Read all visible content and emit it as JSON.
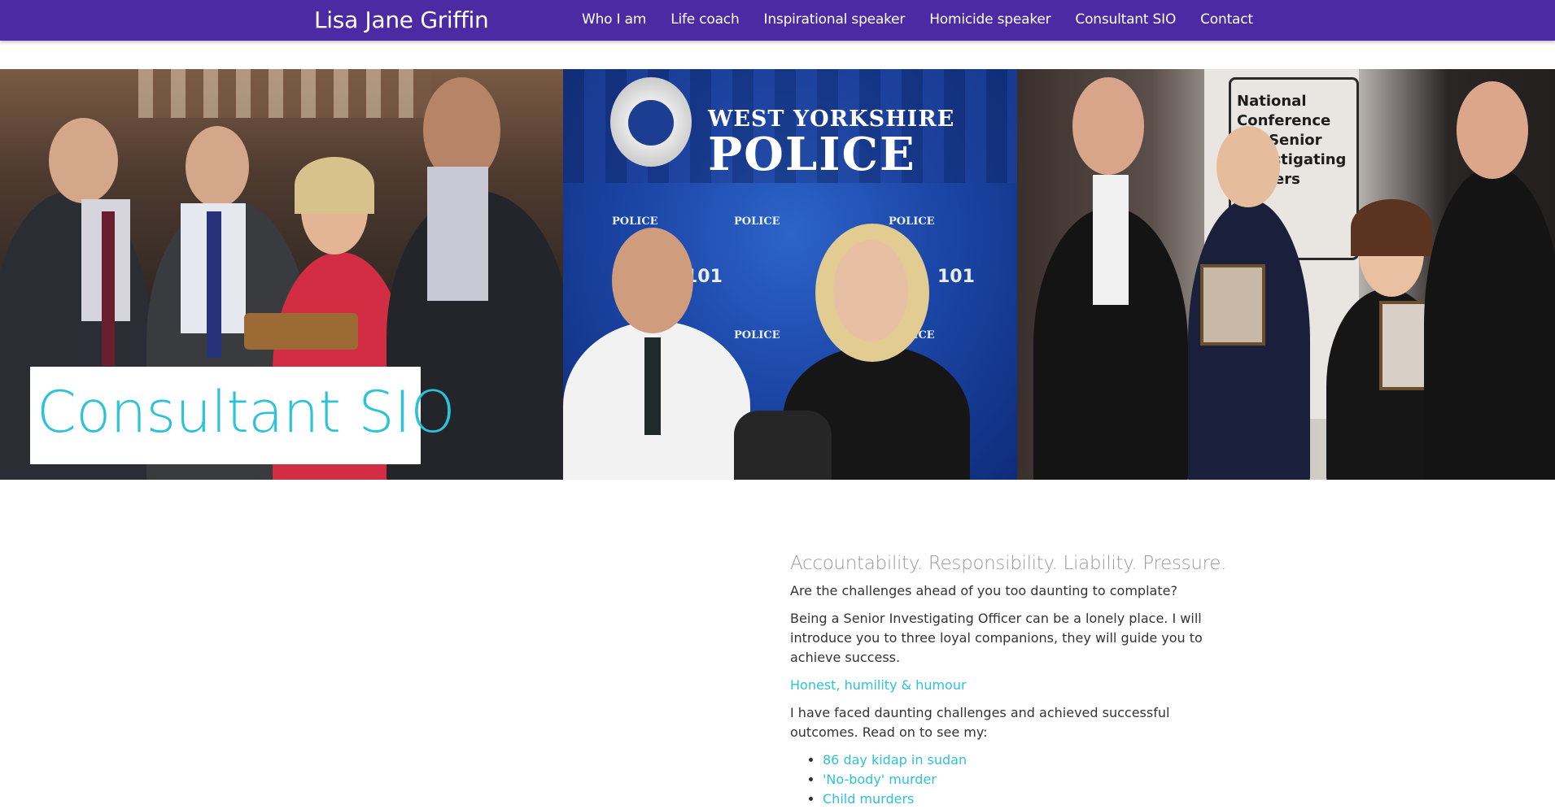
{
  "nav": {
    "brand": "Lisa Jane Griffin",
    "links": [
      {
        "label": "Who I am"
      },
      {
        "label": "Life coach"
      },
      {
        "label": "Inspirational speaker"
      },
      {
        "label": "Homicide speaker"
      },
      {
        "label": "Consultant SIO"
      },
      {
        "label": "Contact"
      }
    ],
    "bg_color": "#4b2aa3"
  },
  "hero": {
    "title": "Consultant SIO",
    "title_color": "#2cc3d8",
    "panel2": {
      "banner_line1": "WEST YORKSHIRE",
      "banner_line2": "POLICE",
      "repeat_logo": "POLICE",
      "number": "101"
    },
    "panel3": {
      "banner_text": "National Conference For Senior Investigating Officers"
    }
  },
  "content": {
    "lead": "Accountability. Responsibility. Liability. Pressure.",
    "p1": "Are the challenges ahead of you too daunting to complate?",
    "p2": "Being a Senior Investigating Officer can be a lonely place. I will introduce you to three loyal companions, they will guide you to achieve success.",
    "highlight": "Honest, humility & humour",
    "p3": "I have faced daunting challenges and achieved successful outcomes. Read on to see my:",
    "list": [
      {
        "label": "86 day kidap in sudan"
      },
      {
        "label": "'No-body' murder"
      },
      {
        "label": "Child murders"
      }
    ]
  }
}
